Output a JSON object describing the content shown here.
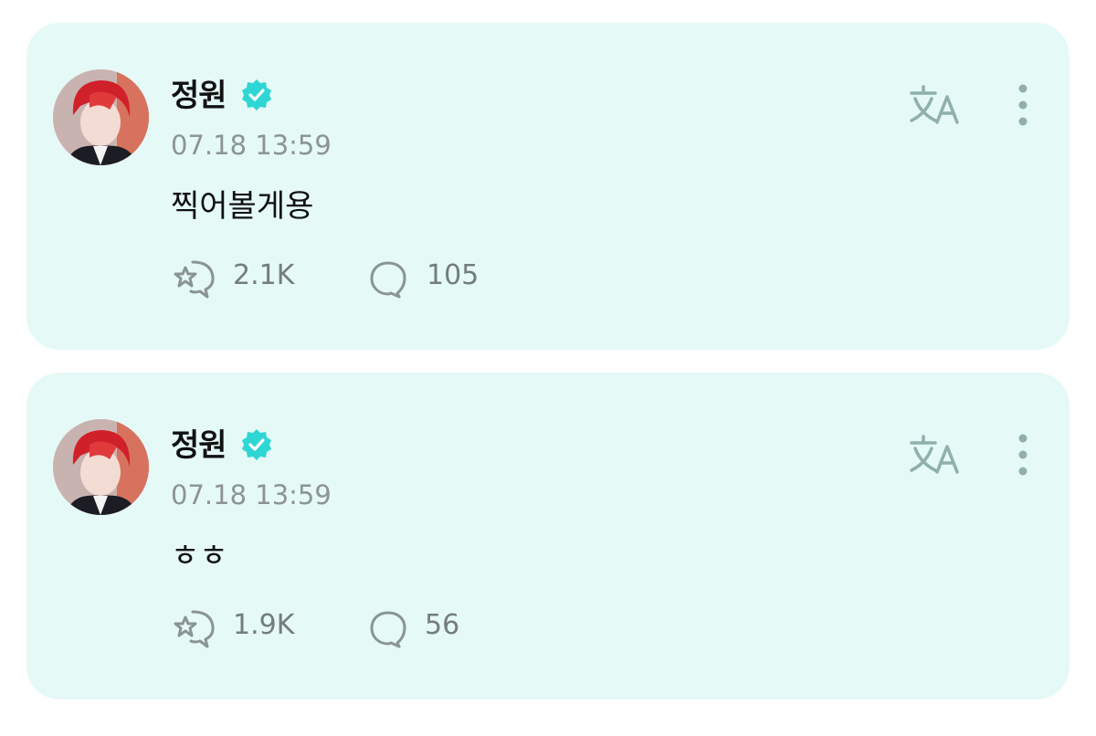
{
  "posts": [
    {
      "author": "정원",
      "timestamp": "07.18 13:59",
      "text": "찍어볼게용",
      "likes": "2.1K",
      "comments": "105"
    },
    {
      "author": "정원",
      "timestamp": "07.18 13:59",
      "text": "ㅎㅎ",
      "likes": "1.9K",
      "comments": "56"
    }
  ],
  "icons": {
    "verified": "verified-badge-icon",
    "translate": "translate-icon",
    "more": "more-vertical-icon",
    "like": "star-bubble-icon",
    "comment": "comment-bubble-icon"
  },
  "colors": {
    "card_background": "#e5f9f6",
    "verified_badge": "#2ed6d4",
    "icon_muted": "#8fb0ad",
    "name": "#111111",
    "timestamp": "#8c9494"
  }
}
